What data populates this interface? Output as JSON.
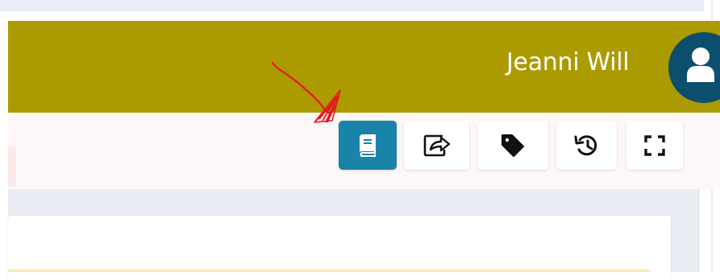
{
  "header": {
    "user_name": "Jeanni Will",
    "background_color": "#ab9a00"
  },
  "avatar": {
    "icon": "user-icon",
    "color": "#0b4e6d"
  },
  "toolbar": {
    "buttons": [
      {
        "icon": "book-icon",
        "active": true
      },
      {
        "icon": "share-icon",
        "active": false
      },
      {
        "icon": "tag-icon",
        "active": false
      },
      {
        "icon": "history-icon",
        "active": false
      },
      {
        "icon": "fullscreen-icon",
        "active": false
      }
    ],
    "active_color": "#1a83a8"
  },
  "annotation": {
    "type": "red-arrow",
    "points_to": "book-icon",
    "color": "#e8141a"
  }
}
